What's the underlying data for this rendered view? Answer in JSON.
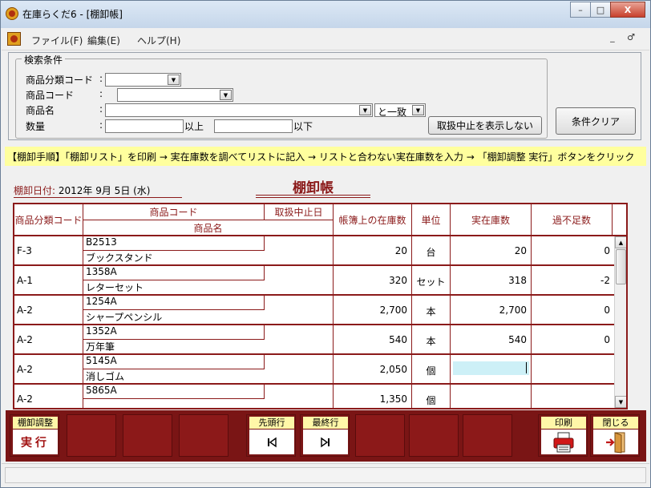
{
  "window": {
    "title": "在庫らくだ6 - [棚卸帳]",
    "controls": {
      "minimize": "–",
      "maximize": "□",
      "close": "X"
    }
  },
  "menu": {
    "items": [
      "ファイル(F)",
      "編集(E)",
      "ヘルプ(H)"
    ],
    "mdi_controls": "_ ♂"
  },
  "search": {
    "legend": "検索条件",
    "category_code_label": "商品分類コード",
    "product_code_label": "商品コード",
    "product_name_label": "商品名",
    "quantity_label": "数量",
    "colon": ":",
    "match_value": "と一致",
    "qty_min_suffix": "以上",
    "qty_max_suffix": "以下",
    "hide_discontinued_button": "取扱中止を表示しない",
    "clear_button": "条件クリア"
  },
  "procedure": "【棚卸手順】「棚卸リスト」を印刷 → 実在庫数を調べてリストに記入 → リストと合わない実在庫数を入力 → 「棚卸調整 実行」ボタンをクリック",
  "header_info": {
    "date_label": "棚卸日付:",
    "date_value": "2012年 9月 5日 (水)",
    "title": "棚卸帳"
  },
  "grid": {
    "columns": {
      "category_code": "商品分類コード",
      "product_code": "商品コード",
      "discontinued_date": "取扱中止日",
      "product_name": "商品名",
      "book_stock": "帳簿上の在庫数",
      "unit": "単位",
      "actual_stock": "実在庫数",
      "difference": "過不足数"
    },
    "rows": [
      {
        "category": "F-3",
        "code": "B2513",
        "discontinued": "",
        "name": "ブックスタンド",
        "book": "20",
        "unit": "台",
        "actual": "20",
        "diff": "0"
      },
      {
        "category": "A-1",
        "code": "1358A",
        "discontinued": "",
        "name": "レターセット",
        "book": "320",
        "unit": "セット",
        "actual": "318",
        "diff": "-2"
      },
      {
        "category": "A-2",
        "code": "1254A",
        "discontinued": "",
        "name": "シャープペンシル",
        "book": "2,700",
        "unit": "本",
        "actual": "2,700",
        "diff": "0"
      },
      {
        "category": "A-2",
        "code": "1352A",
        "discontinued": "",
        "name": "万年筆",
        "book": "540",
        "unit": "本",
        "actual": "540",
        "diff": "0"
      },
      {
        "category": "A-2",
        "code": "5145A",
        "discontinued": "",
        "name": "消しゴム",
        "book": "2,050",
        "unit": "個",
        "actual": "",
        "diff": ""
      },
      {
        "category": "A-2",
        "code": "5865A",
        "discontinued": "",
        "name": "",
        "book": "1,350",
        "unit": "個",
        "actual": "",
        "diff": ""
      }
    ]
  },
  "toolbar": {
    "adjust_caption": "棚卸調整",
    "adjust_face": "実行",
    "first_caption": "先頭行",
    "last_caption": "最終行",
    "print_caption": "印刷",
    "close_caption": "閉じる"
  }
}
